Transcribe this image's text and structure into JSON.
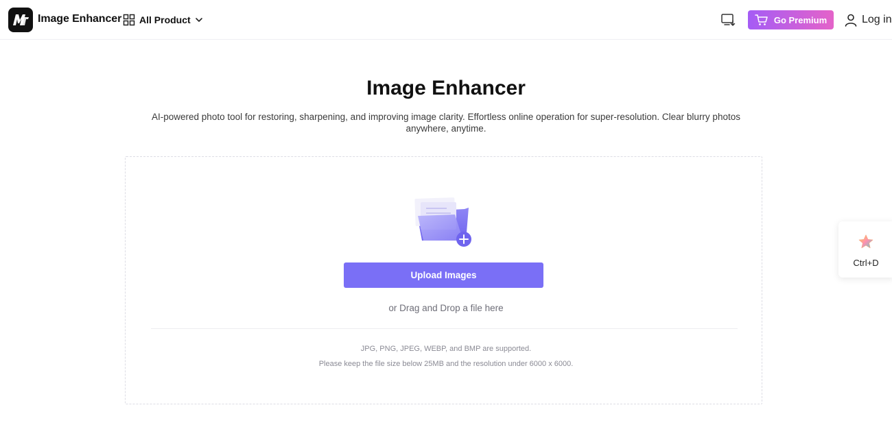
{
  "header": {
    "brand_name": "Image Enhancer",
    "logo_text": "M",
    "all_product_label": "All Product",
    "premium_label": "Go Premium",
    "login_label": "Log in"
  },
  "main": {
    "title": "Image Enhancer",
    "description": "AI-powered photo tool for restoring, sharpening, and improving image clarity. Effortless online operation for super-resolution. Clear blurry photos anywhere, anytime.",
    "upload_button_label": "Upload Images",
    "drag_drop_text": "or Drag and Drop a file here",
    "supported_formats_text": "JPG, PNG, JPEG, WEBP, and BMP are supported.",
    "limits_text": "Please keep the file size below 25MB and the resolution under 6000 x 6000."
  },
  "bookmark": {
    "shortcut_label": "Ctrl+D"
  },
  "colors": {
    "accent": "#7a6ff6",
    "premium_gradient_start": "#a55cf5",
    "premium_gradient_end": "#e463c9"
  },
  "icons": {
    "grid": "grid-icon",
    "chevron": "chevron-down-icon",
    "tool": "desktop-download-icon",
    "cart": "cart-icon",
    "user": "user-icon",
    "folder": "folder-upload-icon",
    "star": "star-icon"
  }
}
